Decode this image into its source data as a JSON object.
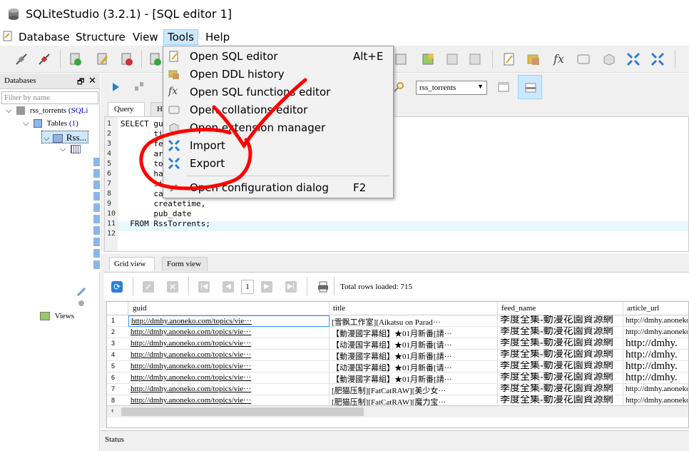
{
  "window": {
    "title": "SQLiteStudio (3.2.1) - [SQL editor 1]"
  },
  "menubar": {
    "items": [
      {
        "label": "Database"
      },
      {
        "label": "Structure"
      },
      {
        "label": "View"
      },
      {
        "label": "Tools"
      },
      {
        "label": "Help"
      }
    ]
  },
  "tools_menu": {
    "items": [
      {
        "label": "Open SQL editor",
        "shortcut": "Alt+E",
        "icon": "sql-editor-icon"
      },
      {
        "label": "Open DDL history",
        "shortcut": "",
        "icon": "ddl-history-icon"
      },
      {
        "label": "Open SQL functions editor",
        "shortcut": "",
        "icon": "fx-icon"
      },
      {
        "label": "Open collations editor",
        "shortcut": "",
        "icon": "collations-icon"
      },
      {
        "label": "Open extension manager",
        "shortcut": "",
        "icon": "extension-icon"
      },
      {
        "label": "Import",
        "shortcut": "",
        "icon": "import-icon"
      },
      {
        "label": "Export",
        "shortcut": "",
        "icon": "export-icon"
      },
      {
        "label": "Open configuration dialog",
        "shortcut": "F2",
        "icon": "config-icon"
      }
    ]
  },
  "databases_panel": {
    "title": "Databases",
    "filter_placeholder": "Filter by name",
    "db_name": "rss_torrents",
    "db_type": "(SQLi",
    "tables_label": "Tables",
    "tables_count": "(1)",
    "table_name": "Rss...",
    "views_label": "Views"
  },
  "sql_toolbar": {
    "db_select": "rss_torrents"
  },
  "editor_tabs": [
    {
      "label": "Query"
    },
    {
      "label": "Hi"
    }
  ],
  "code": {
    "lines": [
      {
        "n": "1",
        "text": "SELECT gu"
      },
      {
        "n": "2",
        "text": "       ti"
      },
      {
        "n": "3",
        "text": "       fe"
      },
      {
        "n": "4",
        "text": "       ar"
      },
      {
        "n": "5",
        "text": "       to"
      },
      {
        "n": "6",
        "text": "       ha"
      },
      {
        "n": "7",
        "text": "       si"
      },
      {
        "n": "8",
        "text": "       ca"
      },
      {
        "n": "9",
        "text": "       createtime,"
      },
      {
        "n": "10",
        "text": "       pub_date"
      },
      {
        "n": "11",
        "text": "  FROM RssTorrents;"
      },
      {
        "n": "12",
        "text": ""
      }
    ]
  },
  "results": {
    "tabs": [
      {
        "label": "Grid view"
      },
      {
        "label": "Form view"
      }
    ],
    "page": "1",
    "total_rows": "Total rows loaded: 715",
    "columns": [
      "guid",
      "title",
      "feed_name",
      "article_url"
    ],
    "rows": [
      {
        "n": "1",
        "guid": "http://dmhy.anoneko.com/topics/vie···",
        "title": "[雪飘工作室][Aikatsu on Parad···",
        "feed": "季度全集-動漫花園資源網",
        "url": "http://dmhy.anoneko"
      },
      {
        "n": "2",
        "guid": "http://dmhy.anoneko.com/topics/vie···",
        "title": "【動漫國字幕組】★01月新番[請···",
        "feed": "季度全集-動漫花園資源網",
        "url": "http://dmhy.anoneko"
      },
      {
        "n": "3",
        "guid": "http://dmhy.anoneko.com/topics/vie···",
        "title": "【动漫国字幕组】★01月新番[请···",
        "feed": "季度全集-動漫花園資源網",
        "url": "http://dmhy."
      },
      {
        "n": "4",
        "guid": "http://dmhy.anoneko.com/topics/vie···",
        "title": "【動漫國字幕組】★01月新番[請···",
        "feed": "季度全集-動漫花園資源網",
        "url": "http://dmhy."
      },
      {
        "n": "5",
        "guid": "http://dmhy.anoneko.com/topics/vie···",
        "title": "【动漫国字幕组】★01月新番[请···",
        "feed": "季度全集-動漫花園資源網",
        "url": "http://dmhy."
      },
      {
        "n": "6",
        "guid": "http://dmhy.anoneko.com/topics/vie···",
        "title": "【動漫國字幕組】★01月新番[請···",
        "feed": "季度全集-動漫花園資源網",
        "url": "http://dmhy."
      },
      {
        "n": "7",
        "guid": "http://dmhy.anoneko.com/topics/vie···",
        "title": "[肥猫压制][FatCatRAW][美少女···",
        "feed": "季度全集-動漫花園資源網",
        "url": "http://dmhy.anoneko"
      },
      {
        "n": "8",
        "guid": "http://dmhy.anoneko.com/topics/vie···",
        "title": "[肥猫压制][FatCatRAW][魔力宝···",
        "feed": "季度全集-動漫花園資源網",
        "url": "http://dmhy.anoneko"
      }
    ]
  },
  "status": {
    "label": "Status"
  },
  "colors": {
    "menu_highlight": "#cce8ff",
    "annotation": "#ff0000",
    "selection": "#3399ff"
  }
}
